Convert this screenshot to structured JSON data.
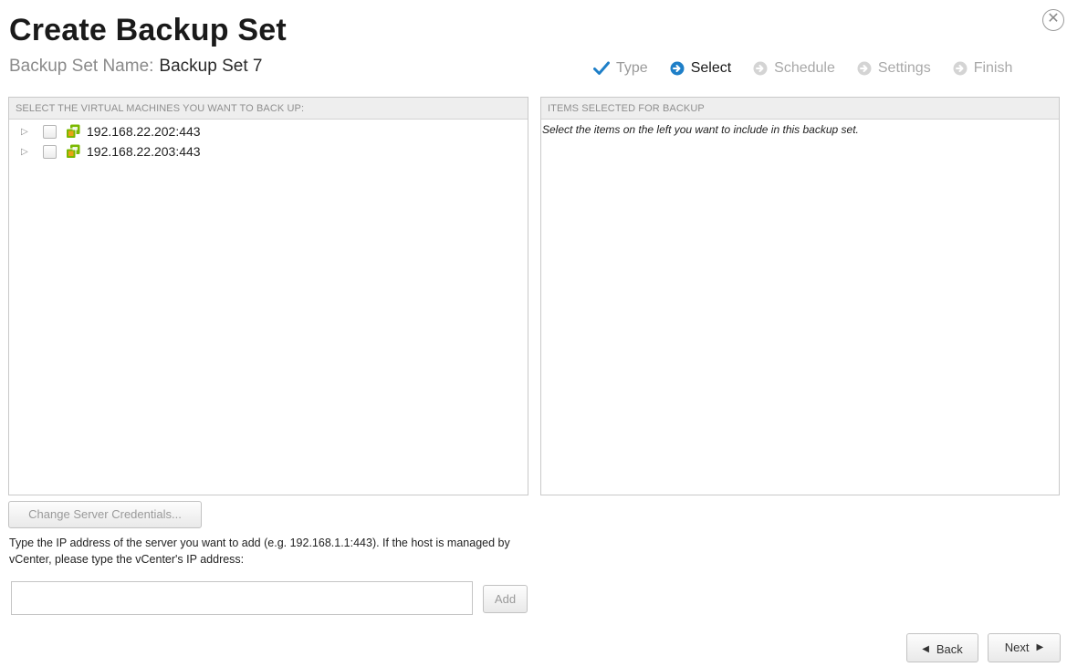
{
  "dialog": {
    "title": "Create Backup Set",
    "close_glyph": "✕"
  },
  "backup_set": {
    "name_label": "Backup Set Name:",
    "name_value": "Backup Set 7"
  },
  "steps": [
    {
      "label": "Type",
      "state": "done",
      "icon": "check-icon"
    },
    {
      "label": "Select",
      "state": "active",
      "icon": "arrow-circle-icon"
    },
    {
      "label": "Schedule",
      "state": "pending",
      "icon": "arrow-circle-icon"
    },
    {
      "label": "Settings",
      "state": "pending",
      "icon": "arrow-circle-icon"
    },
    {
      "label": "Finish",
      "state": "pending",
      "icon": "arrow-circle-icon"
    }
  ],
  "left_panel": {
    "header": "SELECT THE VIRTUAL MACHINES YOU WANT TO BACK UP:",
    "items": [
      {
        "label": "192.168.22.202:443"
      },
      {
        "label": "192.168.22.203:443"
      }
    ]
  },
  "right_panel": {
    "header": "ITEMS SELECTED FOR BACKUP",
    "hint": "Select the items on the left you want to include in this backup set."
  },
  "credentials_button": "Change Server Credentials...",
  "instructions": "Type the IP address of the server you want to add (e.g. 192.168.1.1:443). If the host is managed by vCenter, please type the vCenter's IP address:",
  "ip_input": {
    "value": "",
    "placeholder": ""
  },
  "add_button": "Add",
  "nav": {
    "back": "Back",
    "next": "Next"
  },
  "colors": {
    "step_active_blue": "#1e7fc8",
    "step_done_check": "#1e7fc8",
    "step_pending": "#cfcfcf",
    "vm_icon_green": "#7ab800",
    "vm_icon_orange": "#e8a317"
  }
}
